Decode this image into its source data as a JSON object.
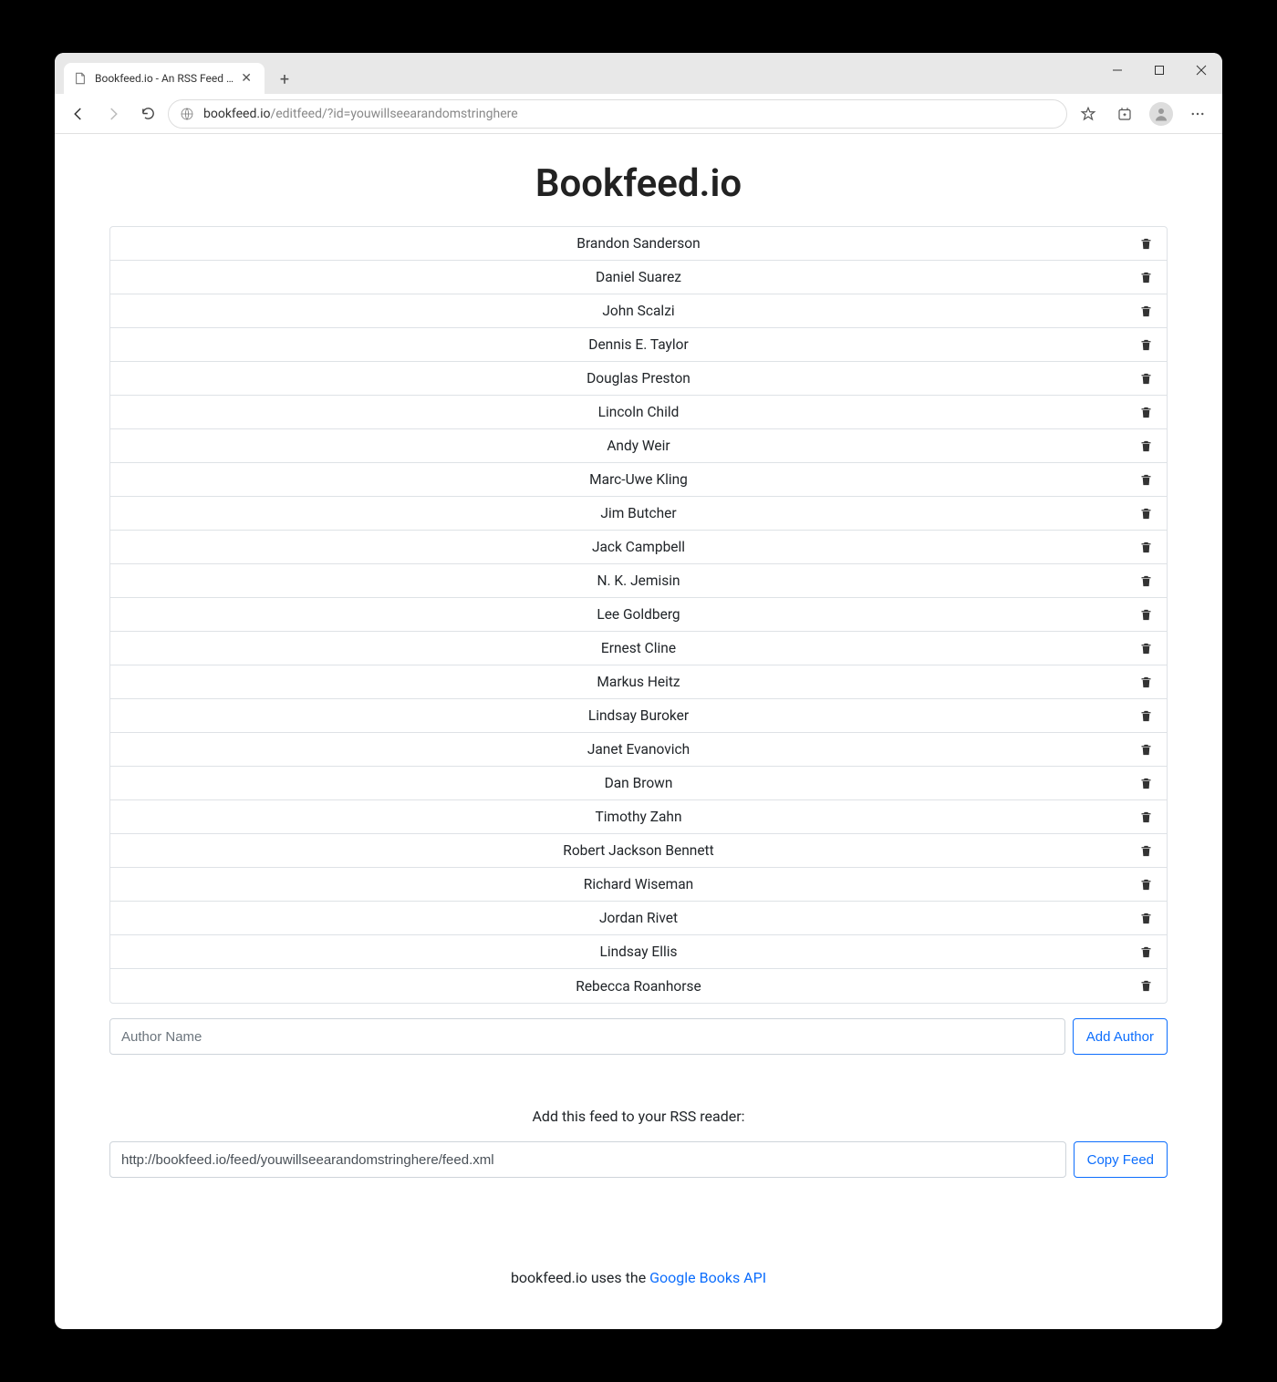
{
  "browser": {
    "tab_title": "Bookfeed.io - An RSS Feed with",
    "url_domain": "bookfeed.io",
    "url_path": "/editfeed/?id=youwillseearandomstringhere"
  },
  "page": {
    "title": "Bookfeed.io",
    "authors": [
      "Brandon Sanderson",
      "Daniel Suarez",
      "John Scalzi",
      "Dennis E. Taylor",
      "Douglas Preston",
      "Lincoln Child",
      "Andy Weir",
      "Marc-Uwe Kling",
      "Jim Butcher",
      "Jack Campbell",
      "N. K. Jemisin",
      "Lee Goldberg",
      "Ernest Cline",
      "Markus Heitz",
      "Lindsay Buroker",
      "Janet Evanovich",
      "Dan Brown",
      "Timothy Zahn",
      "Robert Jackson Bennett",
      "Richard Wiseman",
      "Jordan Rivet",
      "Lindsay Ellis",
      "Rebecca Roanhorse"
    ],
    "author_input_placeholder": "Author Name",
    "add_author_label": "Add Author",
    "rss_label": "Add this feed to your RSS reader:",
    "feed_url": "http://bookfeed.io/feed/youwillseearandomstringhere/feed.xml",
    "copy_feed_label": "Copy Feed",
    "footer_prefix": "bookfeed.io uses the ",
    "footer_link": "Google Books API"
  }
}
